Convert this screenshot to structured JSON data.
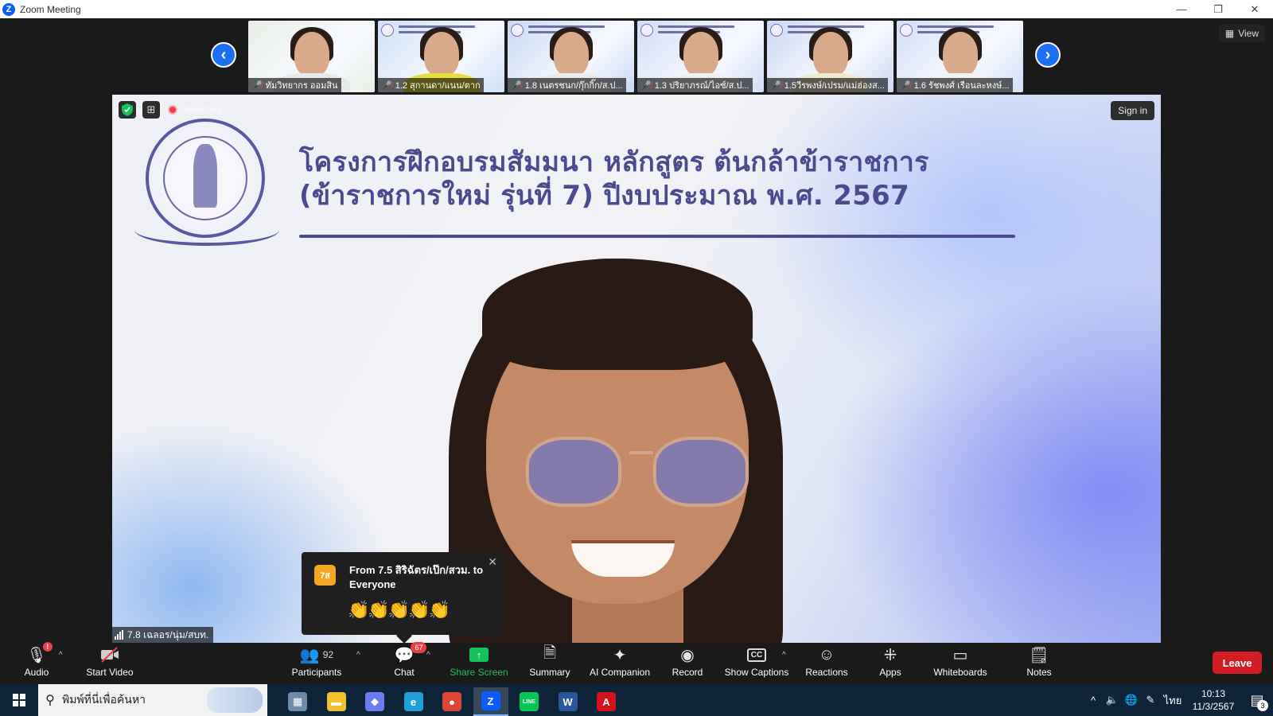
{
  "window": {
    "logo_letter": "Z",
    "title": "Zoom Meeting",
    "min": "—",
    "restore": "❐",
    "close": "✕"
  },
  "gallery": {
    "prev": "‹",
    "next": "›",
    "view_label": "View",
    "participants": [
      {
        "name": "ทัมวิทยากร ออมสิน",
        "bg": "#e8efe6",
        "body": "#e9e9e9"
      },
      {
        "name": "1.2 สุกานดา/แนน/ตาก",
        "bg": "#cfe0f7",
        "body": "#e7df3b"
      },
      {
        "name": "1.8 เนตรชนก/กุ๊กกิ๊ก/ส.ป...",
        "bg": "#c9d9f5",
        "body": "#ececec"
      },
      {
        "name": "1.3 ปริยาภรณ์/ไอซ์/ส.ป...",
        "bg": "#d2ddf6",
        "body": "#f0f0f0"
      },
      {
        "name": "1.5วีรพงษ์/เปรม/แม่ฮ่องส...",
        "bg": "#ccd8f2",
        "body": "#f0ead0"
      },
      {
        "name": "1.6 รัชพงศ์ เรือนละหงษ์...",
        "bg": "#d3def6",
        "body": "#f2f2f2"
      }
    ]
  },
  "main": {
    "recording": "Recording",
    "sign_in": "Sign in",
    "slide_title_1": "โครงการฝึกอบรมสัมมนา หลักสูตร ต้นกล้าข้าราชการ",
    "slide_title_2": "(ข้าราชการใหม่ รุ่นที่ 7) ปีงบประมาณ พ.ศ. 2567",
    "speaker_name": "7.8 เฉลอร/นุ่ม/สบท.",
    "chat_toast": {
      "avatar": "7ส",
      "from": "From 7.5 สิริฉัตร/เป๊ก/สวม. to Everyone",
      "message": "👏👏👏👏👏",
      "close": "✕"
    }
  },
  "toolbar": {
    "audio": "Audio",
    "audio_alert": "!",
    "start_video": "Start Video",
    "participants": "Participants",
    "participants_count": "92",
    "chat": "Chat",
    "chat_badge": "67",
    "share_screen": "Share Screen",
    "summary": "Summary",
    "ai_companion": "AI Companion",
    "record": "Record",
    "show_captions": "Show Captions",
    "reactions": "Reactions",
    "apps": "Apps",
    "whiteboards": "Whiteboards",
    "notes": "Notes",
    "leave": "Leave",
    "caret": "^",
    "cc": "CC"
  },
  "taskbar": {
    "search_placeholder": "พิมพ์ที่นี่เพื่อค้นหา",
    "language": "ไทย",
    "time": "10:13",
    "date": "11/3/2567",
    "notification_count": "3",
    "apps": [
      {
        "name": "app-photos",
        "glyph": "▦",
        "color": "#6d8aa8"
      },
      {
        "name": "app-file-explorer",
        "glyph": "▬",
        "color": "#f2c12e"
      },
      {
        "name": "app-copilot",
        "glyph": "◆",
        "color": "#6a7cf0"
      },
      {
        "name": "app-edge",
        "glyph": "e",
        "color": "#1f9ed8"
      },
      {
        "name": "app-chrome",
        "glyph": "●",
        "color": "#db4437"
      },
      {
        "name": "app-zoom",
        "glyph": "Z",
        "color": "#0b5cff"
      },
      {
        "name": "app-line",
        "glyph": "LINE",
        "color": "#06c755"
      },
      {
        "name": "app-word",
        "glyph": "W",
        "color": "#2b579a"
      },
      {
        "name": "app-acrobat",
        "glyph": "A",
        "color": "#d4111c"
      }
    ]
  }
}
